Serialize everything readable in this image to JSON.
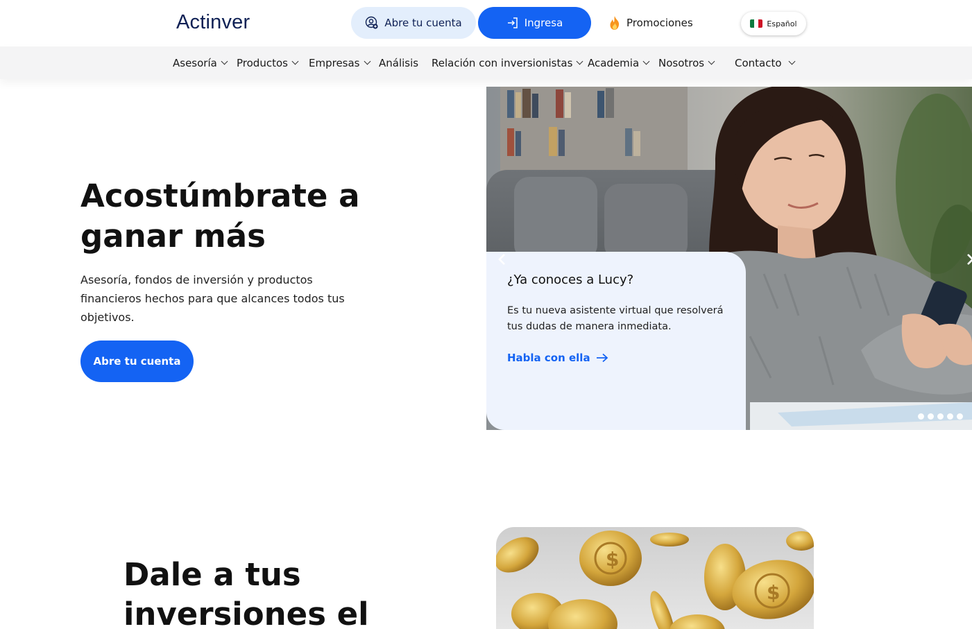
{
  "header": {
    "logo_text": "Actinver",
    "open_account_label": "Abre tu cuenta",
    "login_label": "Ingresa",
    "promotions_label": "Promociones",
    "language_label": "Español",
    "brand_blue": "#1463f3",
    "brand_navy": "#0f2155"
  },
  "nav": {
    "items": [
      {
        "label": "Asesoría",
        "dropdown": true
      },
      {
        "label": "Productos",
        "dropdown": true
      },
      {
        "label": "Empresas",
        "dropdown": true
      },
      {
        "label": "Análisis",
        "dropdown": false
      },
      {
        "label": "Relación con inversionistas",
        "dropdown": true
      },
      {
        "label": "Academia",
        "dropdown": true
      },
      {
        "label": "Nosotros",
        "dropdown": true
      },
      {
        "label": "Contacto",
        "dropdown": true
      }
    ]
  },
  "hero": {
    "title": "Acostúmbrate a ganar más",
    "subtitle": "Asesoría, fondos de inversión y productos financieros hechos para que alcances todos tus objetivos.",
    "cta_label": "Abre tu cuenta"
  },
  "carousel": {
    "card_title": "¿Ya conoces a Lucy?",
    "card_text": "Es tu nueva asistente virtual que resolverá tus dudas de manera inmediata.",
    "card_link": "Habla con ella",
    "slide_count": 5,
    "active_slide": 1
  },
  "section2": {
    "title": "Dale a tus inversiones el"
  }
}
